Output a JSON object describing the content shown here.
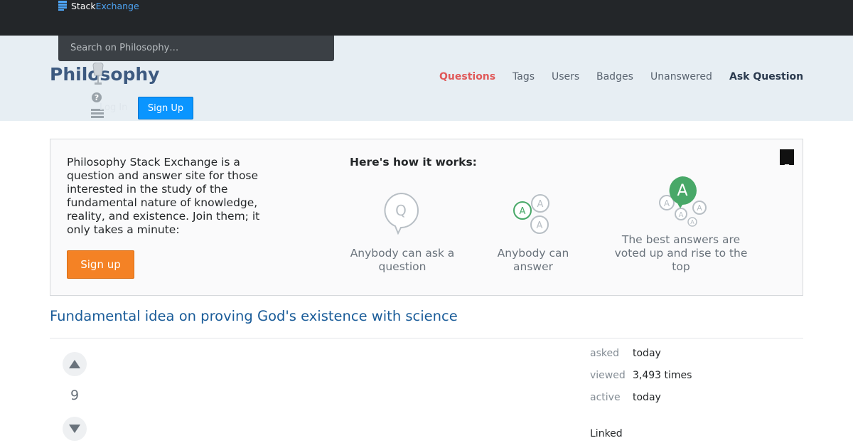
{
  "topbar": {
    "logo_primary": "Stack",
    "logo_secondary": "Exchange"
  },
  "search": {
    "placeholder": "Search on Philosophy…"
  },
  "site": {
    "title": "Philosophy"
  },
  "nav": {
    "questions": "Questions",
    "tags": "Tags",
    "users": "Users",
    "badges": "Badges",
    "unanswered": "Unanswered",
    "ask": "Ask Question"
  },
  "auth": {
    "login": "Log In",
    "signup": "Sign Up"
  },
  "hero": {
    "description": "Philosophy Stack Exchange is a question and answer site for those interested in the study of the fundamental nature of knowledge, reality, and existence. Join them; it only takes a minute:",
    "signup": "Sign up",
    "how_title": "Here's how it works:",
    "steps": [
      {
        "icon": "question-bubble-icon",
        "label": "Anybody can ask a question"
      },
      {
        "icon": "answer-bubbles-icon",
        "label": "Anybody can answer"
      },
      {
        "icon": "top-answer-icon",
        "label": "The best answers are voted up and rise to the top"
      }
    ],
    "close": "_"
  },
  "question": {
    "title": "Fundamental idea on proving God's existence with science",
    "score": "9",
    "meta": {
      "asked_label": "asked",
      "asked_value": "today",
      "viewed_label": "viewed",
      "viewed_value": "3,493 times",
      "active_label": "active",
      "active_value": "today"
    },
    "linked_label": "Linked"
  },
  "colors": {
    "topbar": "#232629",
    "accent_orange": "#f48225",
    "link_blue": "#1a5c99",
    "nav_active": "#e05a5a",
    "answer_green": "#48a868"
  }
}
